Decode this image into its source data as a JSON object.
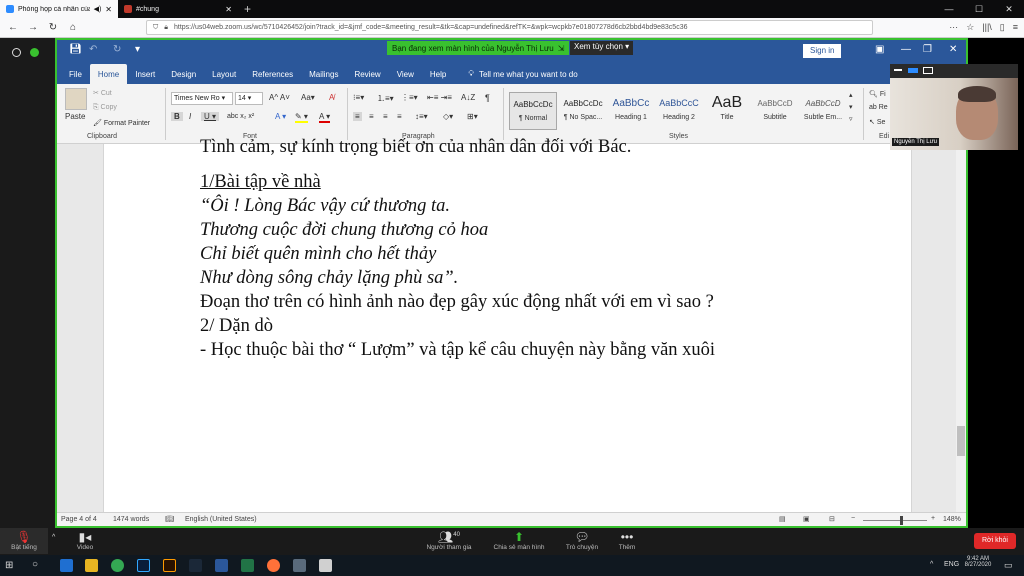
{
  "browser": {
    "tabs": [
      {
        "label": "Phòng họp cá nhân của N..."
      },
      {
        "label": "#chung"
      }
    ],
    "url": "https://us04web.zoom.us/wc/5710426452/join?track_id=&jmf_code=&meeting_result=&tk=&cap=undefined&refTK=&wpk=wcpkb7e01807278d6cb2bbd4bd9e83c5c36"
  },
  "zoom": {
    "share_banner": "Bạn đang xem màn hình của Nguyễn Thị Lưu",
    "view_options": "Xem tùy chọn",
    "participant_name": "Nguyễn Thị Lưu",
    "participants_count": "40",
    "controls": {
      "mute": "Bật tiếng",
      "video": "Video",
      "participants": "Người tham gia",
      "share": "Chia sẻ màn hình",
      "chat": "Trò chuyện",
      "more": "Thêm",
      "leave": "Rời khỏi"
    }
  },
  "word": {
    "sign_in": "Sign in",
    "tabs": [
      "File",
      "Home",
      "Insert",
      "Design",
      "Layout",
      "References",
      "Mailings",
      "Review",
      "View",
      "Help"
    ],
    "tell_me": "Tell me what you want to do",
    "clipboard": {
      "paste": "Paste",
      "cut": "Cut",
      "copy": "Copy",
      "format_painter": "Format Painter",
      "label": "Clipboard"
    },
    "font": {
      "name": "Times New Ro",
      "size": "14",
      "label": "Font"
    },
    "paragraph_label": "Paragraph",
    "styles_label": "Styles",
    "styles": [
      {
        "preview": "AaBbCcDc",
        "name": "¶ Normal"
      },
      {
        "preview": "AaBbCcDc",
        "name": "¶ No Spac..."
      },
      {
        "preview": "AaBbCc",
        "name": "Heading 1"
      },
      {
        "preview": "AaBbCcC",
        "name": "Heading 2"
      },
      {
        "preview": "AaB",
        "name": "Title"
      },
      {
        "preview": "AaBbCcD",
        "name": "Subtitle"
      },
      {
        "preview": "AaBbCcD",
        "name": "Subtle Em..."
      }
    ],
    "editing": {
      "find": "Fi",
      "replace": "Re",
      "select": "Se",
      "label": "Edi"
    },
    "document_lines": [
      "Tình cảm, sự kính trọng biết ơn của nhân dân đối với Bác.",
      "1/Bài tập về nhà",
      "“Ôi ! Lòng Bác vậy cứ thương ta.",
      "Thương cuộc đời chung thương cỏ hoa",
      "Chỉ biết quên mình cho hết thảy",
      "Như dòng sông chảy lặng phù sa”.",
      "Đoạn thơ trên có hình ảnh nào đẹp gây xúc động nhất với em vì sao ?",
      "2/ Dặn dò",
      "- Học thuộc bài thơ “ Lượm”  và tập kể câu chuyện này bằng văn xuôi"
    ],
    "status": {
      "page": "Page 4 of 4",
      "words": "1474 words",
      "language": "English (United States)",
      "zoom": "148%"
    }
  },
  "taskbar": {
    "lang": "ENG",
    "time": "9:42 AM",
    "date": "8/27/2020"
  }
}
